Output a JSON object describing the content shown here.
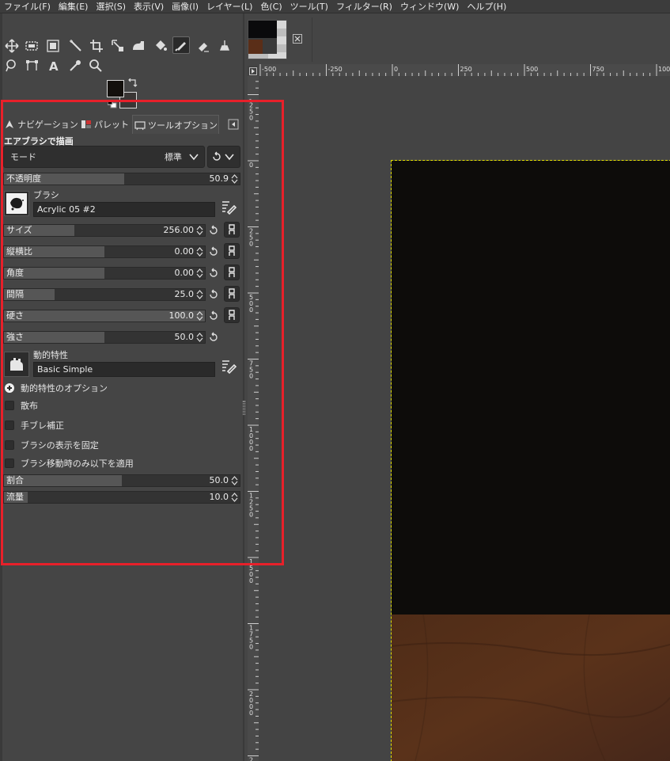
{
  "menubar": {
    "items": [
      "ファイル(F)",
      "編集(E)",
      "選択(S)",
      "表示(V)",
      "画像(I)",
      "レイヤー(L)",
      "色(C)",
      "ツール(T)",
      "フィルター(R)",
      "ウィンドウ(W)",
      "ヘルプ(H)"
    ]
  },
  "toolbox": {
    "tools": [
      {
        "name": "move-tool-icon",
        "active": false
      },
      {
        "name": "rect-select-tool-icon",
        "active": false
      },
      {
        "name": "fuzzy-select-tool-icon",
        "active": false
      },
      {
        "name": "crop-tool-icon",
        "active": false
      },
      {
        "name": "unified-transform-tool-icon",
        "active": false
      },
      {
        "name": "warp-transform-tool-icon",
        "active": false
      },
      {
        "name": "bucket-fill-tool-icon",
        "active": false
      },
      {
        "name": "airbrush-tool-icon",
        "active": true
      },
      {
        "name": "eraser-tool-icon",
        "active": false
      },
      {
        "name": "clone-tool-icon",
        "active": false
      },
      {
        "name": "smudge-tool-icon",
        "active": false
      },
      {
        "name": "paths-tool-icon",
        "active": false
      },
      {
        "name": "text-tool-icon",
        "active": false
      },
      {
        "name": "color-picker-tool-icon",
        "active": false
      },
      {
        "name": "zoom-tool-icon",
        "active": false
      }
    ],
    "fg_color": "#13100d",
    "bg_color": "#3a3635"
  },
  "dock": {
    "tabs": {
      "navigation": "ナビゲーション",
      "palette": "パレット",
      "tool_options": "ツールオプション"
    },
    "panel_title": "エアブラシで描画",
    "mode": {
      "label": "モード",
      "value": "標準"
    },
    "opacity": {
      "label": "不透明度",
      "value": "50.9",
      "fraction": 0.509
    },
    "brush": {
      "label": "ブラシ",
      "value": "Acrylic 05 #2"
    },
    "size": {
      "label": "サイズ",
      "value": "256.00",
      "fraction": 0.35
    },
    "aspect": {
      "label": "縦横比",
      "value": "0.00",
      "fraction": 0.5
    },
    "angle": {
      "label": "角度",
      "value": "0.00",
      "fraction": 0.5
    },
    "spacing": {
      "label": "間隔",
      "value": "25.0",
      "fraction": 0.25
    },
    "hardness": {
      "label": "硬さ",
      "value": "100.0",
      "fraction": 1.0
    },
    "force": {
      "label": "強さ",
      "value": "50.0",
      "fraction": 0.5
    },
    "dynamics": {
      "label": "動的特性",
      "value": "Basic Simple"
    },
    "dynamics_options": "動的特性のオプション",
    "scatter": "散布",
    "smoothing": "手ブレ補正",
    "lock_brush_view": "ブラシの表示を固定",
    "incremental": "ブラシ移動時のみ以下を適用",
    "rate": {
      "label": "割合",
      "value": "50.0",
      "fraction": 0.5
    },
    "flow": {
      "label": "流量",
      "value": "10.0",
      "fraction": 0.1
    }
  },
  "ruler": {
    "h_labels": [
      "-500",
      "-250",
      "0",
      "250",
      "500",
      "750",
      "1000"
    ],
    "v_labels": [
      "-250",
      "0",
      "250",
      "500",
      "750",
      "1000",
      "1250",
      "1500",
      "1750",
      "2000",
      "2250"
    ]
  },
  "image": {
    "top_color": "#0d0c0a",
    "bottom_color": "#4a2a18"
  }
}
